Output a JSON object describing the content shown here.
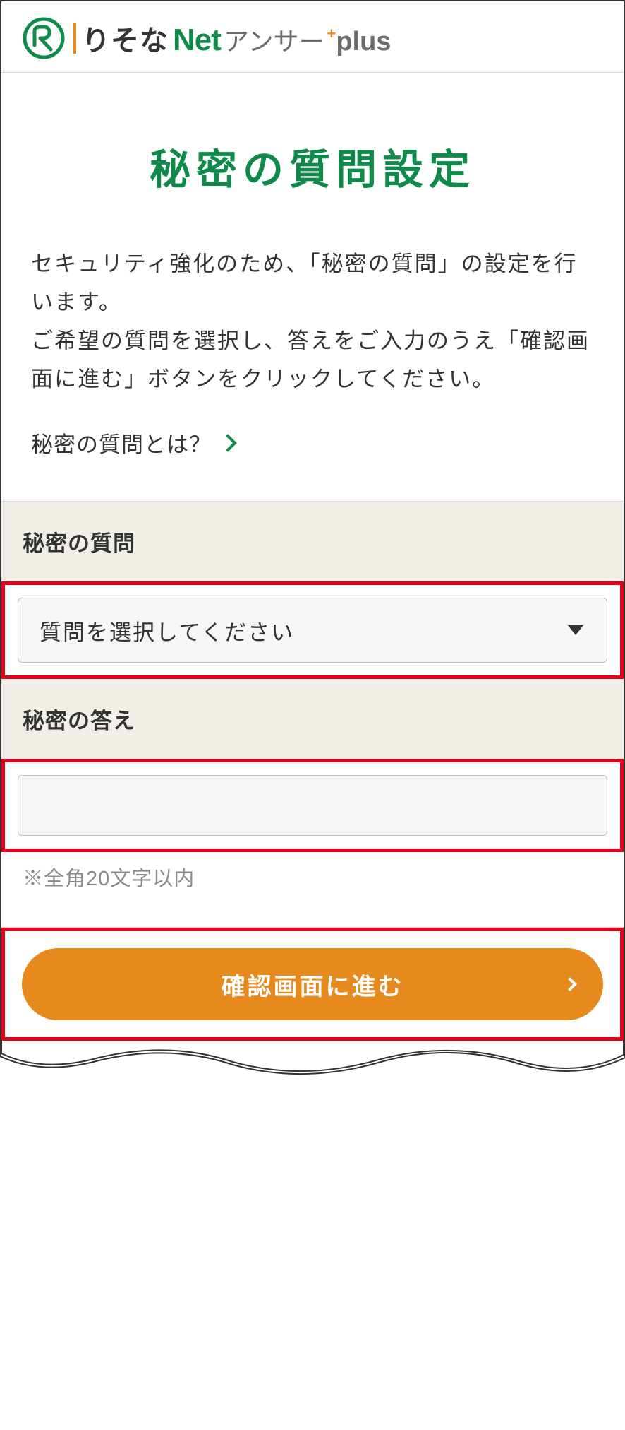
{
  "header": {
    "logo_risona": "りそな",
    "logo_net": "Net",
    "logo_answer": "アンサー",
    "logo_plus_cross": "+",
    "logo_plus": "plus"
  },
  "page": {
    "title": "秘密の質問設定",
    "intro_line1": "セキュリティ強化のため、「秘密の質問」の設定を行います。",
    "intro_line2": "ご希望の質問を選択し、答えをご入力のうえ「確認画面に進む」ボタンをクリックしてください。",
    "help_link": "秘密の質問とは？"
  },
  "form": {
    "question_label": "秘密の質問",
    "question_placeholder": "質問を選択してください",
    "answer_label": "秘密の答え",
    "answer_hint": "※全角20文字以内",
    "submit_label": "確認画面に進む"
  }
}
